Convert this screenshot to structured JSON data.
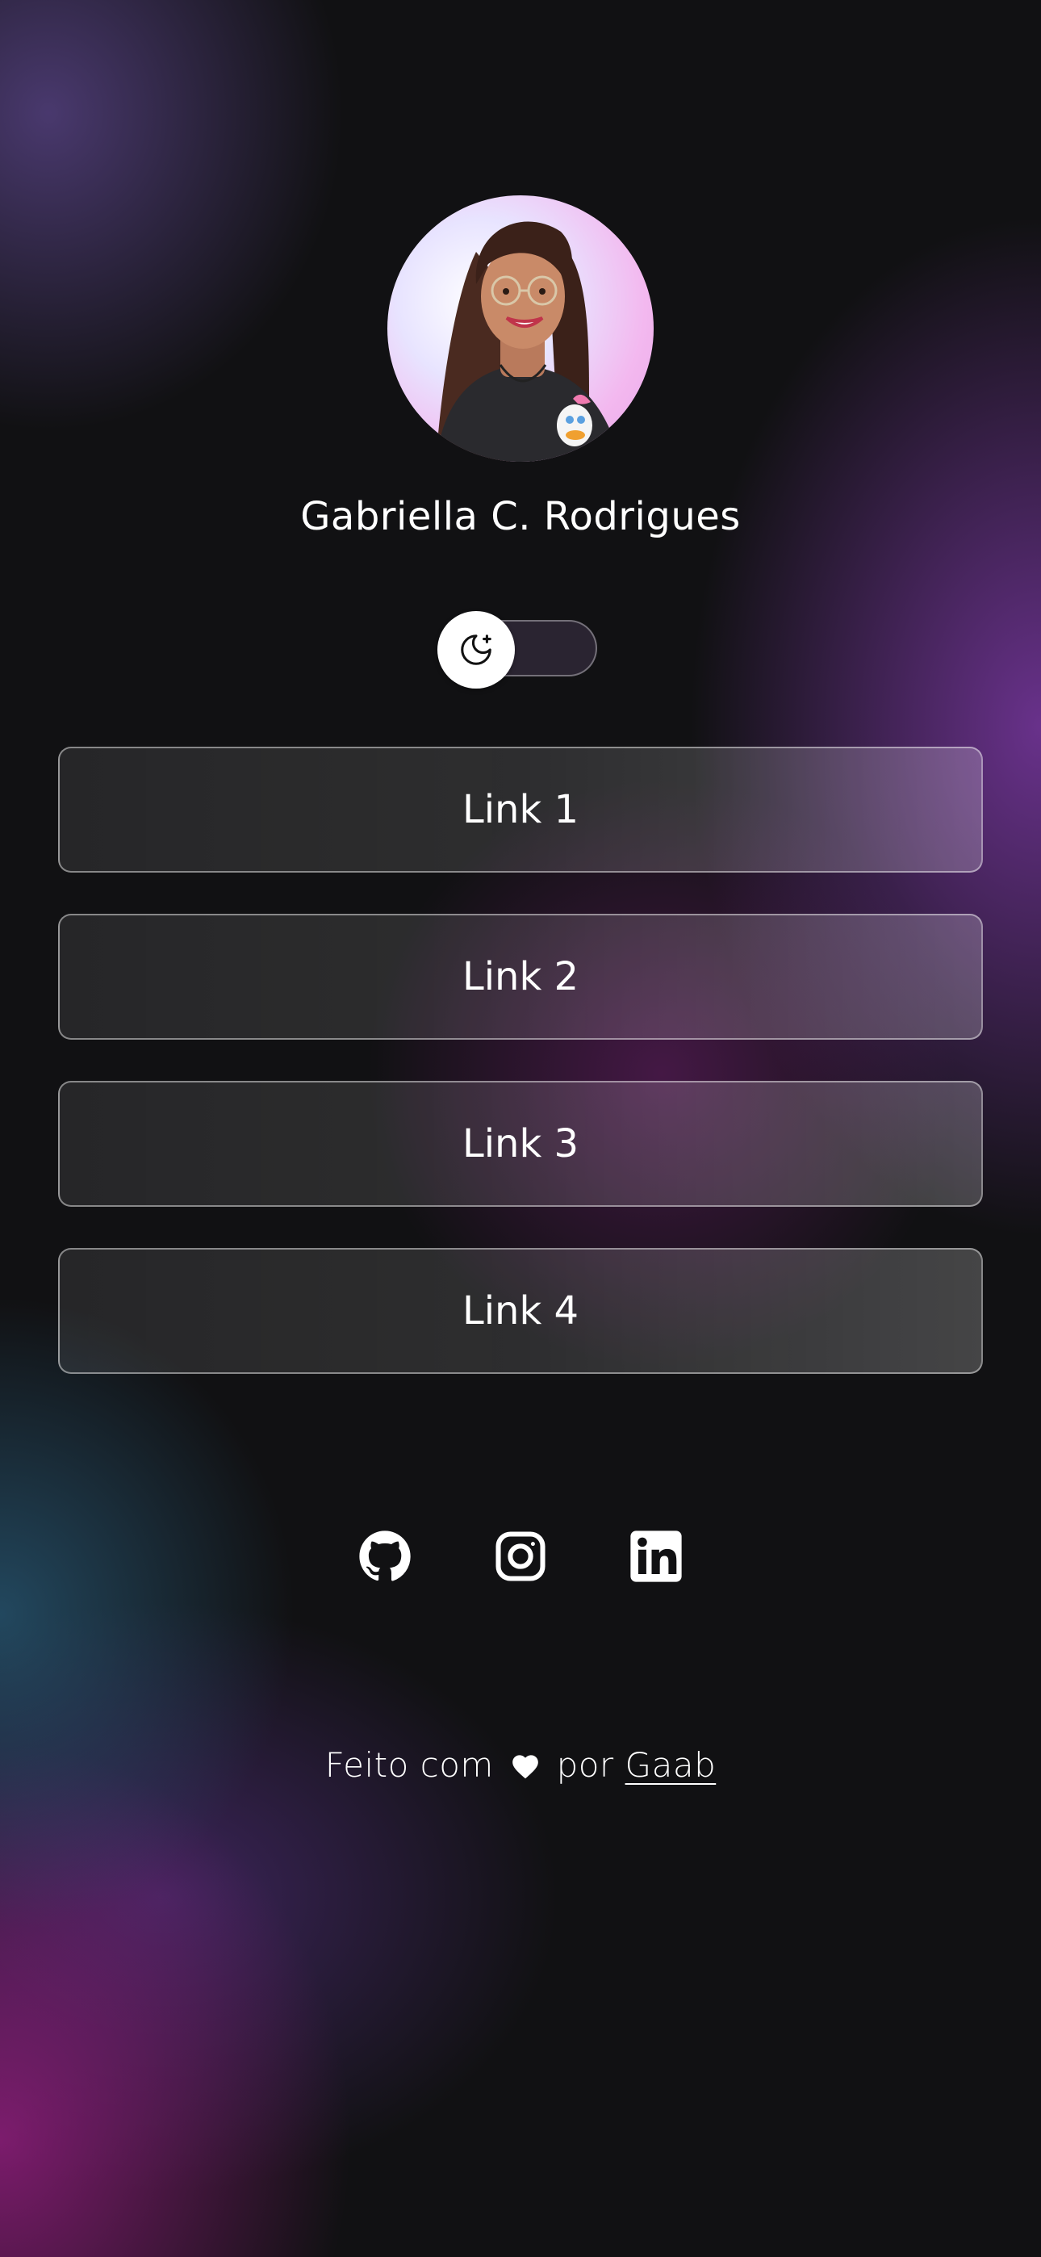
{
  "profile": {
    "name": "Gabriella C. Rodrigues",
    "avatar_alt": "avatar"
  },
  "theme_toggle": {
    "icon": "moon-stars-icon",
    "state": "dark"
  },
  "links": [
    {
      "label": "Link 1"
    },
    {
      "label": "Link 2"
    },
    {
      "label": "Link 3"
    },
    {
      "label": "Link 4"
    }
  ],
  "socials": [
    {
      "icon": "github-icon"
    },
    {
      "icon": "instagram-icon"
    },
    {
      "icon": "linkedin-icon"
    }
  ],
  "footer": {
    "prefix": "Feito com",
    "heart_icon": "heart-icon",
    "middle": "por",
    "author": "Gaab"
  },
  "colors": {
    "background": "#111113",
    "text": "#ffffff",
    "accent_purple": "#7a37a0",
    "accent_pink": "#961e82",
    "accent_teal": "#285a78"
  }
}
